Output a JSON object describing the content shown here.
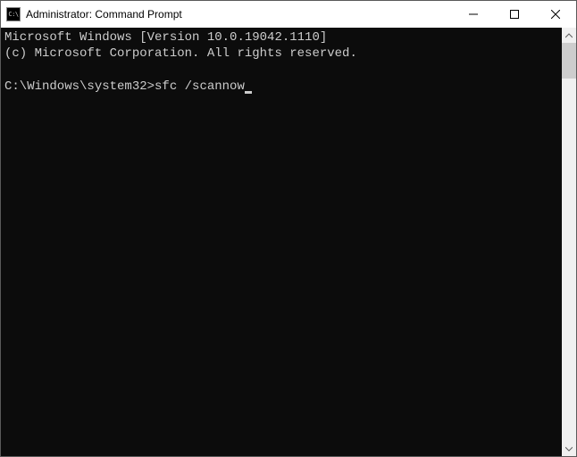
{
  "window": {
    "title": "Administrator: Command Prompt",
    "icon_label": "C:\\"
  },
  "terminal": {
    "line1": "Microsoft Windows [Version 10.0.19042.1110]",
    "line2": "(c) Microsoft Corporation. All rights reserved.",
    "blank": "",
    "prompt": "C:\\Windows\\system32>",
    "command": "sfc /scannow"
  }
}
